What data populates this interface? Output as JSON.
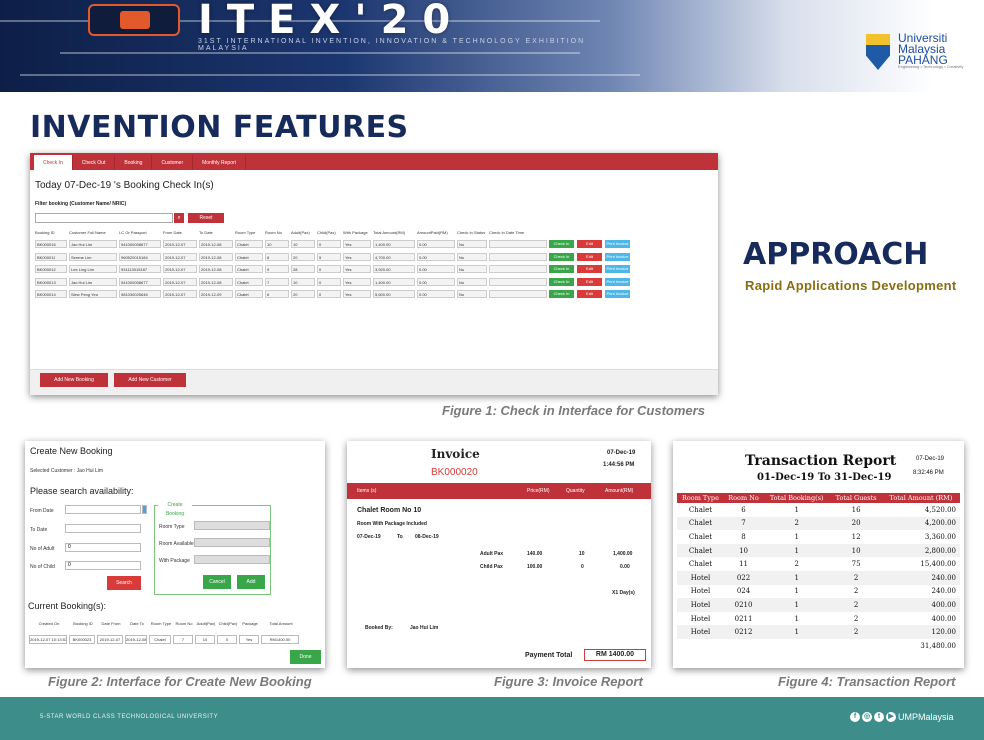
{
  "banner": {
    "title": "ITEX'20",
    "subtitle": "31ST INTERNATIONAL INVENTION, INNOVATION & TECHNOLOGY EXHIBITION MALAYSIA"
  },
  "university": {
    "line1": "Universiti",
    "line2": "Malaysia",
    "line3": "PAHANG",
    "tagline": "Engineering • Technology • Creativity"
  },
  "heading": "INVENTION FEATURES",
  "approach": {
    "title": "APPROACH",
    "subtitle": "Rapid Applications  Development"
  },
  "fig1": {
    "caption": "Figure 1: Check in Interface for Customers",
    "tabs": [
      "Check In",
      "Check Out",
      "Booking",
      "Customer",
      "Monthly Report"
    ],
    "title": "Today 07-Dec-19 's Booking Check In(s)",
    "filter_label": "Filter booking (Customer Name/ NRIC)",
    "search_icon": "search-icon",
    "reset_label": "Reset",
    "columns": [
      "Booking ID",
      "Customer Full Name",
      "I.C Or Passport",
      "From Date",
      "To Date",
      "Room Type",
      "Room No",
      "Adult(Pax)",
      "Child(Pax)",
      "With Package",
      "Total Amount(RM)",
      "AmountPaid(RM)",
      "Check In Status",
      "Check In Date Time"
    ],
    "rows": [
      [
        "BK000016",
        "Jao Hui Lim",
        "941000008677",
        "2019-12-07",
        "2019-12-08",
        "Chalet",
        "10",
        "10",
        "0",
        "Yes",
        "1,400.00",
        "0.00",
        "No",
        ""
      ],
      [
        "BK000011",
        "Serene Lim",
        "960520015184",
        "2019-12-07",
        "2019-12-08",
        "Chalet",
        "8",
        "20",
        "5",
        "Yes",
        "4,700.00",
        "0.00",
        "No",
        ""
      ],
      [
        "BK000012",
        "Lee Ling Lim",
        "931113015187",
        "2019-12-07",
        "2019-12-08",
        "Chalet",
        "9",
        "28",
        "0",
        "Yes",
        "3,920.00",
        "0.00",
        "No",
        ""
      ],
      [
        "BK000013",
        "Jao Hui Lim",
        "941000008677",
        "2019-12-07",
        "2019-12-08",
        "Chalet",
        "7",
        "10",
        "0",
        "Yes",
        "1,400.00",
        "0.00",
        "No",
        ""
      ],
      [
        "BK000014",
        "Siew Peng Yeu",
        "981030025646",
        "2019-12-07",
        "2019-12-09",
        "Chalet",
        "6",
        "20",
        "0",
        "Yes",
        "5,600.00",
        "0.00",
        "No",
        ""
      ]
    ],
    "actions": [
      "Check In",
      "Edit",
      "Print Invoice"
    ],
    "add_booking": "Add New Booking",
    "add_customer": "Add New Customer"
  },
  "fig2": {
    "caption": "Figure 2: Interface for Create New Booking",
    "title": "Create New Booking",
    "selected_customer": "Selected Customer :   Jao Hui Lim",
    "search_heading": "Please search availability:",
    "from_label": "From Date",
    "to_label": "To Date",
    "adult_label": "No of Adult",
    "child_label": "No of Child",
    "adult_value": "0",
    "child_value": "0",
    "search_label": "Search",
    "group_title": "Create Booking",
    "room_type_label": "Room Type",
    "room_avail_label": "Room Available",
    "package_label": "With Package",
    "cancel_label": "Cancel",
    "add_label": "Add",
    "current_heading": "Current Booking(s):",
    "columns": [
      "Created On",
      "Booking ID",
      "Date From",
      "Date To",
      "Room Type",
      "Room No",
      "Adult(Pax)",
      "Child(Pax)",
      "Package",
      "Total Amount"
    ],
    "row": [
      "2019-12-07 10:13:57",
      "BK000023",
      "2019-12-07",
      "2019-12-08",
      "Chalet",
      "7",
      "10",
      "0",
      "Yes",
      "RM1400.00"
    ],
    "done_label": "Done"
  },
  "fig3": {
    "caption": "Figure 3: Invoice Report",
    "title": "Invoice",
    "booking_id": "BK000020",
    "date": "07-Dec-19",
    "time": "1:44:56 PM",
    "col_item": "Items (s)",
    "col_price": "Price(RM)",
    "col_qty": "Quantity",
    "col_amount": "Amount(RM)",
    "item_title": "Chalet Room No 10",
    "package_line": "Room With Package Included",
    "date_from": "07-Dec-19",
    "to_word": "To",
    "date_to": "08-Dec-19",
    "adult_label": "Adult Pax",
    "adult_price": "140.00",
    "adult_qty": "10",
    "adult_amount": "1,400.00",
    "child_label": "Child Pax",
    "child_price": "100.00",
    "child_qty": "0",
    "child_amount": "0.00",
    "days": "X1 Day(s)",
    "booked_by_label": "Booked By:",
    "booked_by": "Jao Hui Lim",
    "total_label": "Payment Total",
    "total": "RM 1400.00"
  },
  "fig4": {
    "caption": "Figure 4: Transaction Report",
    "title": "Transaction Report",
    "range": "01-Dec-19 To  31-Dec-19",
    "date": "07-Dec-19",
    "time": "8:32:46 PM",
    "columns": [
      "Room Type",
      "Room No",
      "Total Booking(s)",
      "Total Guests",
      "Total Amount (RM)"
    ],
    "rows": [
      [
        "Chalet",
        "6",
        "1",
        "16",
        "4,520.00"
      ],
      [
        "Chalet",
        "7",
        "2",
        "20",
        "4,200.00"
      ],
      [
        "Chalet",
        "8",
        "1",
        "12",
        "3,360.00"
      ],
      [
        "Chalet",
        "10",
        "1",
        "10",
        "2,800.00"
      ],
      [
        "Chalet",
        "11",
        "2",
        "75",
        "15,400.00"
      ],
      [
        "Hotel",
        "022",
        "1",
        "2",
        "240.00"
      ],
      [
        "Hotel",
        "024",
        "1",
        "2",
        "240.00"
      ],
      [
        "Hotel",
        "0210",
        "1",
        "2",
        "400.00"
      ],
      [
        "Hotel",
        "0211",
        "1",
        "2",
        "400.00"
      ],
      [
        "Hotel",
        "0212",
        "1",
        "2",
        "120.00"
      ]
    ],
    "grand_total": "31,480.00"
  },
  "footer": {
    "left": "5-STAR WORLD CLASS TECHNOLOGICAL UNIVERSITY",
    "handle": "UMPMalaysia",
    "icons": [
      "facebook-icon",
      "instagram-icon",
      "twitter-icon",
      "youtube-icon"
    ]
  }
}
